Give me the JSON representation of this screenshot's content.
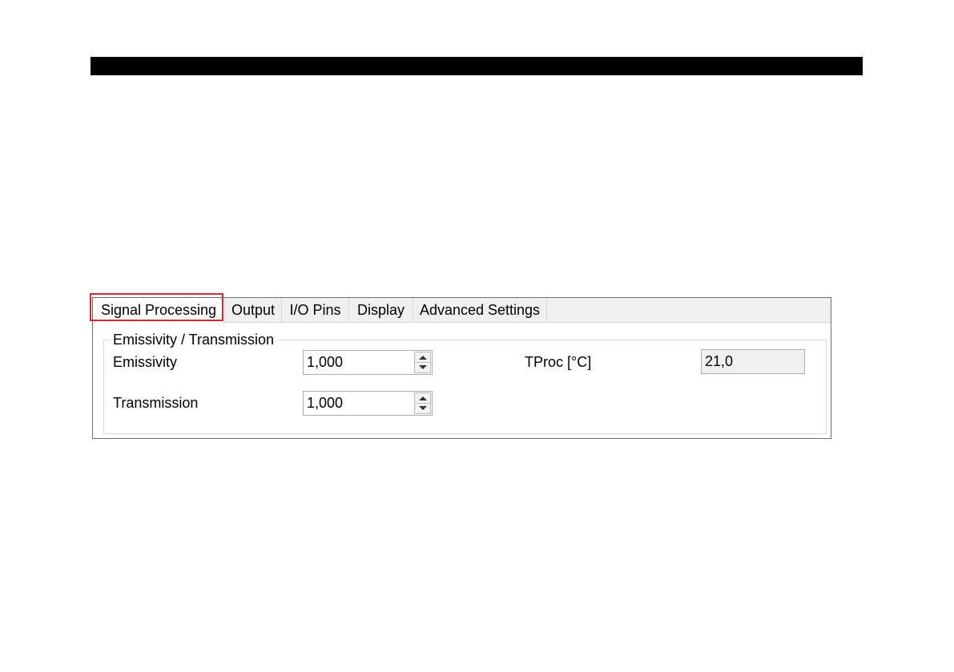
{
  "tabs": [
    {
      "label": "Signal Processing",
      "active": true
    },
    {
      "label": "Output",
      "active": false
    },
    {
      "label": "I/O Pins",
      "active": false
    },
    {
      "label": "Display",
      "active": false
    },
    {
      "label": "Advanced Settings",
      "active": false
    }
  ],
  "group": {
    "title": "Emissivity / Transmission",
    "emissivity": {
      "label": "Emissivity",
      "value": "1,000"
    },
    "transmission": {
      "label": "Transmission",
      "value": "1,000"
    },
    "tproc": {
      "label": "TProc [°C]",
      "value": "21,0"
    }
  },
  "colors": {
    "highlight": "#d9262e",
    "tab_bg": "#f0f0f0",
    "top_bar": "#000000"
  }
}
